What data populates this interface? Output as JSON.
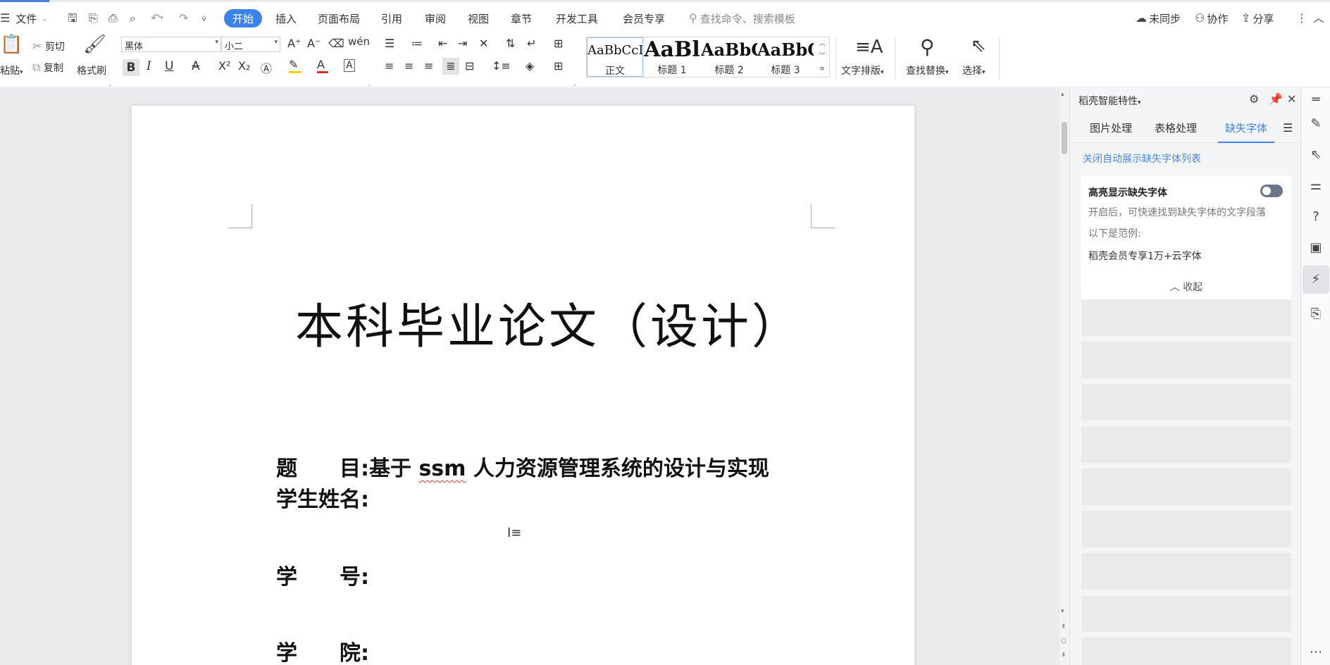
{
  "menubar": {
    "file": "文件",
    "tabs": [
      {
        "label": "开始",
        "active": true
      },
      {
        "label": "插入"
      },
      {
        "label": "页面布局"
      },
      {
        "label": "引用"
      },
      {
        "label": "审阅"
      },
      {
        "label": "视图"
      },
      {
        "label": "章节"
      },
      {
        "label": "开发工具"
      },
      {
        "label": "会员专享"
      }
    ],
    "search_placeholder": "查找命令、搜索模板",
    "sync": "未同步",
    "collab": "协作",
    "share": "分享"
  },
  "ribbon": {
    "paste": "粘贴",
    "cut": "剪切",
    "copy": "复制",
    "format_painter": "格式刷",
    "font_name": "黑体",
    "font_size": "小二",
    "styles": [
      {
        "sample": "AaBbCcI",
        "name": "正文"
      },
      {
        "sample": "AaBl",
        "name": "标题 1"
      },
      {
        "sample": "AaBbC",
        "name": "标题 2"
      },
      {
        "sample": "AaBbC",
        "name": "标题 3"
      }
    ],
    "text_layout": "文字排版",
    "find_replace": "查找替换",
    "select": "选择"
  },
  "document": {
    "title": "本科毕业论文（设计）",
    "fields": [
      {
        "label": "题　　目:",
        "prefix": "基于 ",
        "squiggle": "ssm",
        "suffix": " 人力资源管理系统的设计与实现"
      },
      {
        "label": "学生姓名:"
      },
      {
        "label": "学　　号:"
      },
      {
        "label": "学　　院:"
      }
    ]
  },
  "panel": {
    "header": "稻壳智能特性",
    "tabs": [
      "图片处理",
      "表格处理",
      "缺失字体"
    ],
    "active_tab": "缺失字体",
    "link": "关闭自动展示缺失字体列表",
    "card": {
      "title": "高亮显示缺失字体",
      "toggle_on": false,
      "desc": "开启后，可快速找到缺失字体的文字段落",
      "example_label": "以下是范例:",
      "example": "稻壳会员专享1万+云字体",
      "collapse": "收起"
    }
  },
  "icons": {
    "colors": {
      "accent": "#3d82e6",
      "font_color_bar": "#d22f2f",
      "highlight_bar": "#f5d000"
    }
  }
}
